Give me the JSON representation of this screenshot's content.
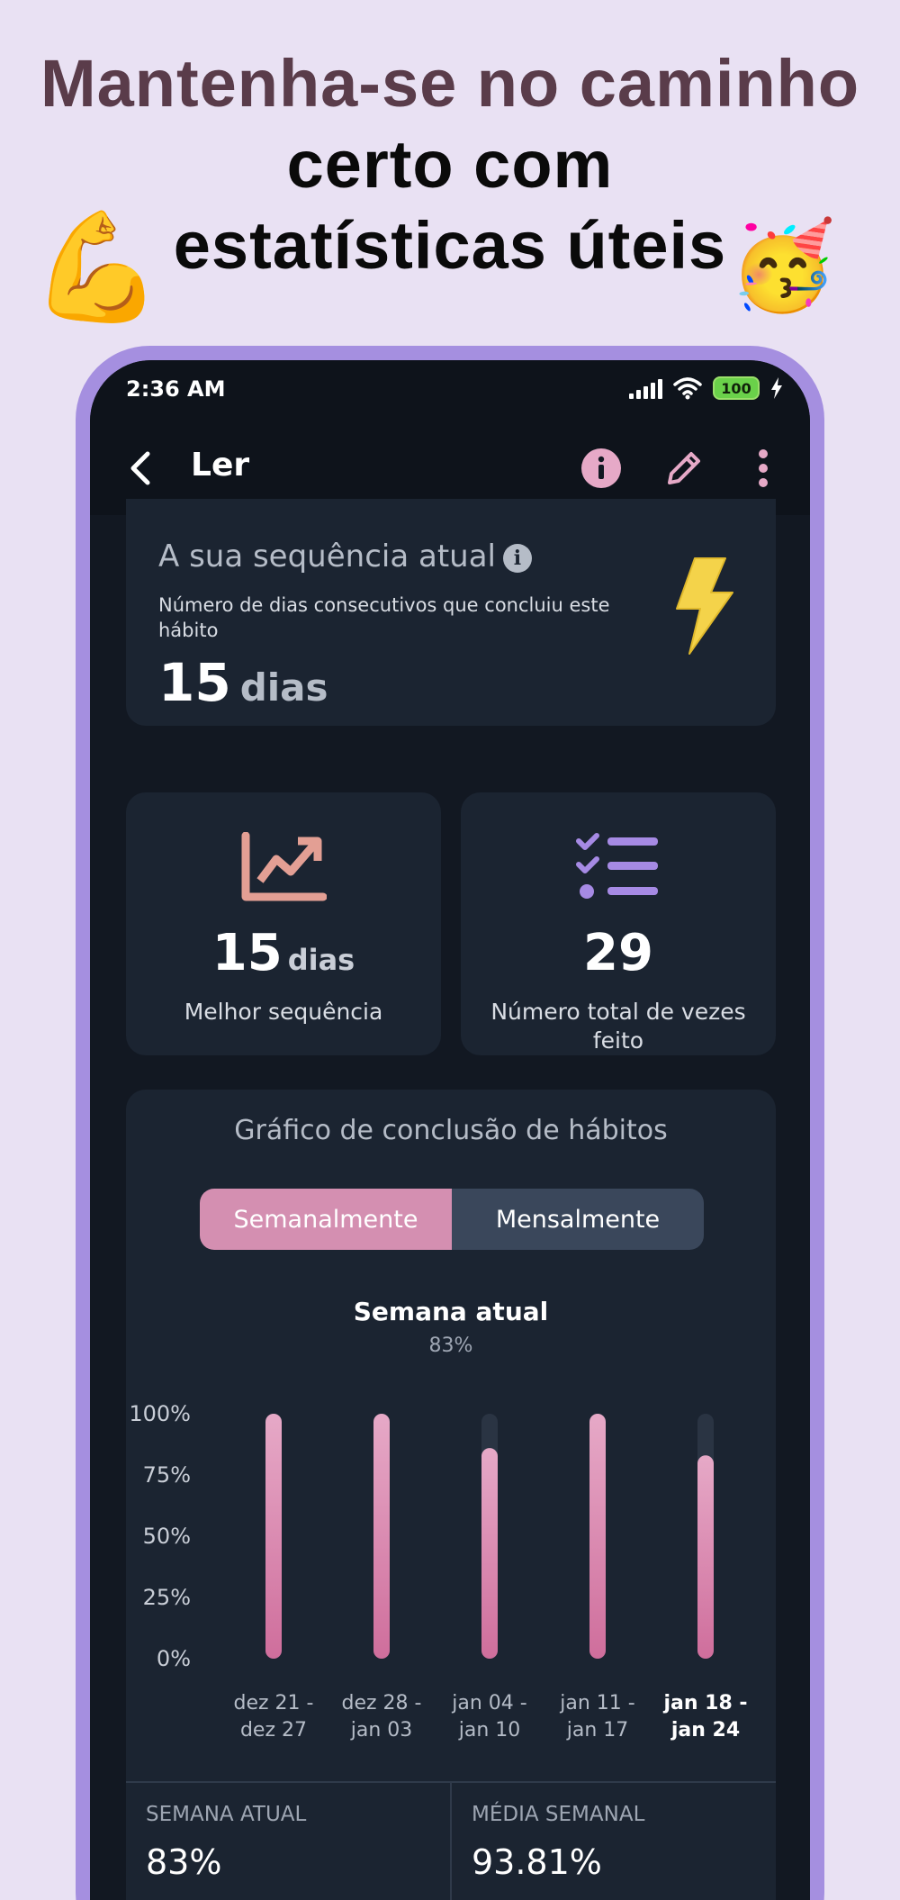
{
  "promo": {
    "headline_highlight": "Mantenha-se no caminho",
    "headline_rest": "certo com estatísticas úteis",
    "emoji_left": "💪",
    "emoji_right": "🥳"
  },
  "status_bar": {
    "time": "2:36 AM",
    "battery": "100"
  },
  "app_bar": {
    "title": "Ler",
    "icons": [
      "back-icon",
      "info-icon",
      "edit-icon",
      "more-icon"
    ]
  },
  "streak": {
    "title": "A sua sequência atual",
    "description": "Número de dias consecutivos que concluiu este hábito",
    "value": "15",
    "unit": "dias",
    "icon": "lightning-icon"
  },
  "best_streak": {
    "value": "15",
    "unit": "dias",
    "label": "Melhor sequência",
    "icon": "trend-chart-icon"
  },
  "total_done": {
    "value": "29",
    "label": "Número total de vezes feito",
    "icon": "checklist-icon"
  },
  "habit_chart": {
    "title": "Gráfico de conclusão de hábitos",
    "tabs": [
      "Semanalmente",
      "Mensalmente"
    ],
    "active_tab": "Semanalmente",
    "period_label": "Semana atual",
    "period_value": "83%"
  },
  "chart_data": {
    "type": "bar",
    "categories": [
      [
        "dez 21 -",
        "dez 27"
      ],
      [
        "dez 28 -",
        "jan 03"
      ],
      [
        "jan 04 -",
        "jan 10"
      ],
      [
        "jan 11 -",
        "jan 17"
      ],
      [
        "jan 18 -",
        "jan 24"
      ]
    ],
    "values": [
      100,
      100,
      86,
      100,
      83
    ],
    "y_ticks": [
      "100%",
      "75%",
      "50%",
      "25%",
      "0%"
    ],
    "ylim": [
      0,
      100
    ],
    "highlight_index": 4,
    "colors": {
      "bar_top": "#e6a9c7",
      "bar_bottom": "#cf6e9c",
      "track": "#2a3443"
    }
  },
  "summary": {
    "current_week_label": "SEMANA ATUAL",
    "current_week_value": "83%",
    "weekly_avg_label": "MÉDIA SEMANAL",
    "weekly_avg_value": "93.81%"
  }
}
